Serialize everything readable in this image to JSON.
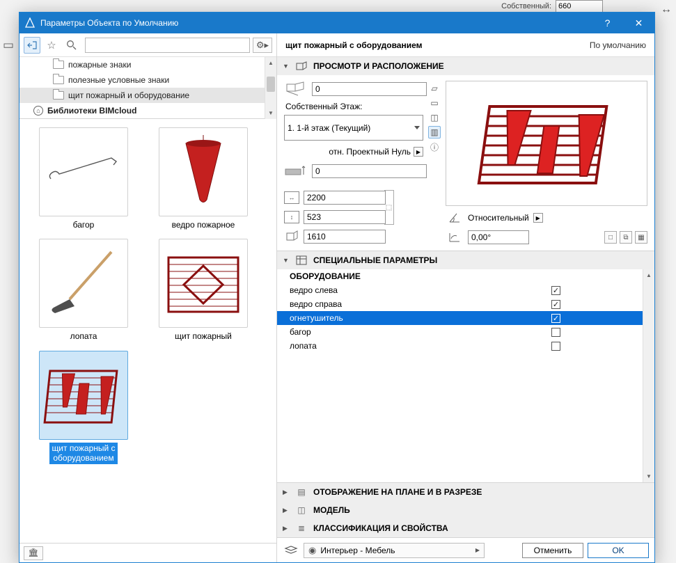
{
  "outer": {
    "own_label": "Собственный:",
    "own_value": "660"
  },
  "dialog": {
    "title": "Параметры Объекта по Умолчанию"
  },
  "toolbar": {
    "search_placeholder": ""
  },
  "tree": {
    "items": [
      {
        "label": "пожарные знаки"
      },
      {
        "label": "полезные условные знаки"
      },
      {
        "label": "щит пожарный и оборудование"
      }
    ],
    "lib": "Библиотеки BIMcloud"
  },
  "gallery": {
    "items": [
      {
        "label": "багор"
      },
      {
        "label": "ведро пожарное"
      },
      {
        "label": "лопата"
      },
      {
        "label": "щит пожарный"
      },
      {
        "label_l1": "щит пожарный с",
        "label_l2": "оборудованием"
      }
    ]
  },
  "right": {
    "object_name": "щит пожарный с оборудованием",
    "default_text": "По умолчанию"
  },
  "sec1": {
    "title": "ПРОСМОТР И РАСПОЛОЖЕНИЕ",
    "elev": "0",
    "own_story_label": "Собственный Этаж:",
    "story_value": "1. 1-й этаж (Текущий)",
    "proj_zero": "отн. Проектный Нуль",
    "elev2": "0",
    "w": "2200",
    "d": "523",
    "h": "1610",
    "rel_label": "Относительный",
    "angle": "0,00°"
  },
  "sec2": {
    "title": "СПЕЦИАЛЬНЫЕ ПАРАМЕТРЫ",
    "group": "ОБОРУДОВАНИЕ",
    "rows": [
      {
        "name": "ведро слева",
        "on": true
      },
      {
        "name": "ведро справа",
        "on": true
      },
      {
        "name": "огнетушитель",
        "on": true,
        "sel": true
      },
      {
        "name": "багор",
        "on": false
      },
      {
        "name": "лопата",
        "on": false
      }
    ]
  },
  "sec3": {
    "title": "ОТОБРАЖЕНИЕ НА ПЛАНЕ И В РАЗРЕЗЕ"
  },
  "sec4": {
    "title": "МОДЕЛЬ"
  },
  "sec5": {
    "title": "КЛАССИФИКАЦИЯ И СВОЙСТВА"
  },
  "footer": {
    "layer": "Интерьер - Мебель",
    "cancel": "Отменить",
    "ok": "OK"
  }
}
